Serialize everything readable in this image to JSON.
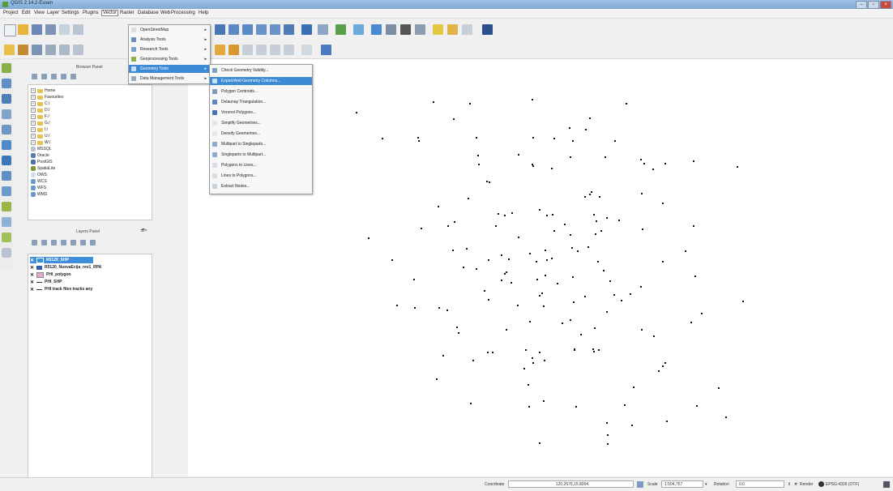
{
  "window": {
    "title": "QGIS 2.14.2-Essen",
    "min": "–",
    "max": "▫",
    "close": "×"
  },
  "menubar": [
    "Project",
    "Edit",
    "View",
    "Layer",
    "Settings",
    "Plugins",
    "Vector",
    "Raster",
    "Database",
    "Web",
    "Processing",
    "Help"
  ],
  "vector_menu": [
    {
      "label": "OpenStreetMap",
      "arrow": "▸"
    },
    {
      "label": "Analysis Tools",
      "arrow": "▸"
    },
    {
      "label": "Research Tools",
      "arrow": "▸"
    },
    {
      "label": "Geoprocessing Tools",
      "arrow": "▸"
    },
    {
      "label": "Geometry Tools",
      "arrow": "▸"
    },
    {
      "label": "Data Management Tools",
      "arrow": "▸"
    }
  ],
  "geometry_tools_menu": [
    "Check Geometry Validity...",
    "Export/Add Geometry Columns...",
    "Polygon Centroids...",
    "Delaunay Triangulation...",
    "Voronoi Polygons...",
    "Simplify Geometries...",
    "Densify Geometries...",
    "Multipart to Singleparts...",
    "Singleparts to Multipart...",
    "Polygons to Lines...",
    "Lines to Polygons...",
    "Extract Nodes..."
  ],
  "browser_panel": {
    "title": "Browser Panel",
    "items": [
      "Home",
      "Favourites",
      "C:/",
      "D:/",
      "F:/",
      "G:/",
      "I:/",
      "U:/",
      "W:/",
      "MSSQL",
      "Oracle",
      "PostGIS",
      "SpatiaLite",
      "OWS",
      "WCS",
      "WFS",
      "WMS"
    ]
  },
  "layers_panel": {
    "title": "Layers Panel",
    "close": "🗗×",
    "layers": [
      {
        "name": "R5120_SHP",
        "check": "✕",
        "color": "#3e8edb"
      },
      {
        "name": "R5120_NuevaEcija_rev1_RPA",
        "check": "✕",
        "color": "#2e5fa8"
      },
      {
        "name": "PHI_polygon",
        "check": "✕",
        "color": "#e7a6d1"
      },
      {
        "name": "PHI_SHP",
        "check": "✕",
        "color": "#333333"
      },
      {
        "name": "PHI track files tracks any",
        "check": "✕",
        "color": "#333333"
      }
    ]
  },
  "statusbar": {
    "coordinate_label": "Coordinate",
    "coordinate_value": "120.2676,15.8004",
    "scale_label": "Scale",
    "scale_value": "1:504,757",
    "rotation_label": "Rotation",
    "rotation_value": "0.0",
    "render_label": "Render",
    "crs": "EPSG:4326 (OTF)"
  },
  "colors": {
    "highlight": "#3d8ad6",
    "titlebar": "#8fb6df"
  }
}
